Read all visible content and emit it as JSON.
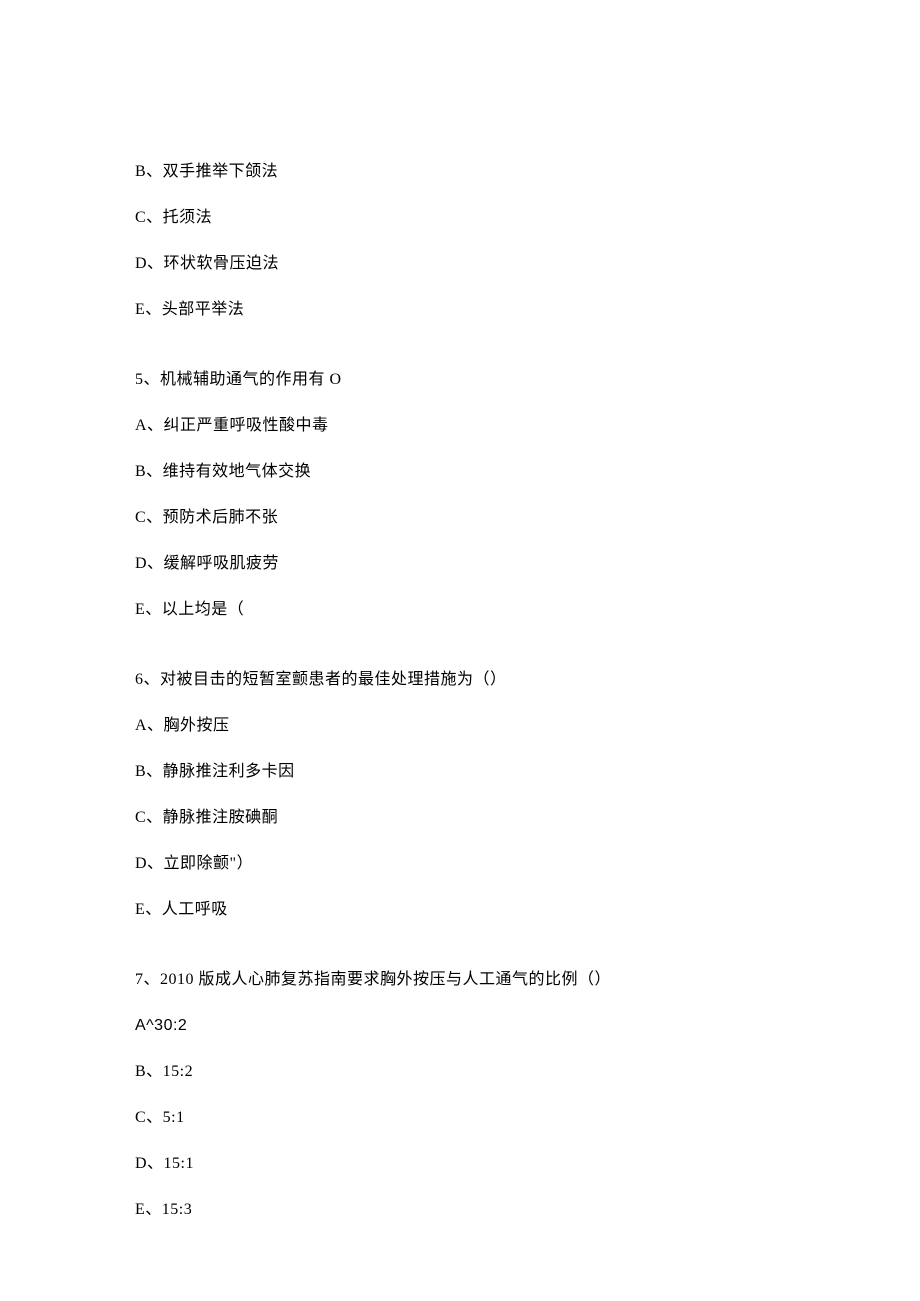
{
  "q4_options": {
    "b": "B、双手推举下颌法",
    "c": "C、托须法",
    "d": "D、环状软骨压迫法",
    "e": "E、头部平举法"
  },
  "q5": {
    "stem": "5、机械辅助通气的作用有 O",
    "a": "A、纠正严重呼吸性酸中毒",
    "b": "B、维持有效地气体交换",
    "c": "C、预防术后肺不张",
    "d": "D、缓解呼吸肌疲劳",
    "e": "E、以上均是（"
  },
  "q6": {
    "stem": "6、对被目击的短暂室颤患者的最佳处理措施为（）",
    "a": "A、胸外按压",
    "b": "B、静脉推注利多卡因",
    "c": "C、静脉推注胺碘酮",
    "d": "D、立即除颤\"）",
    "e": "E、人工呼吸"
  },
  "q7": {
    "stem": "7、2010 版成人心肺复苏指南要求胸外按压与人工通气的比例（）",
    "a": "A^30:2",
    "b": "B、15:2",
    "c": "C、5:1",
    "d": "D、15:1",
    "e": "E、15:3"
  }
}
